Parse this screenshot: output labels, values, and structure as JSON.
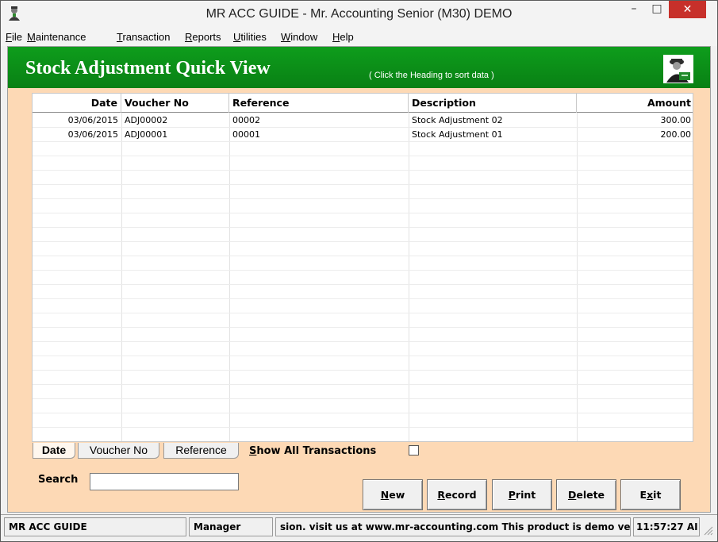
{
  "window": {
    "title": "MR ACC GUIDE - Mr. Accounting Senior (M30) DEMO",
    "min_glyph": "–",
    "max_glyph": "□",
    "close_glyph": "✕"
  },
  "menu": [
    {
      "pre": "",
      "u": "F",
      "post": "ile"
    },
    {
      "pre": "",
      "u": "M",
      "post": "aintenance"
    },
    {
      "pre": "",
      "u": "T",
      "post": "ransaction"
    },
    {
      "pre": "",
      "u": "R",
      "post": "eports"
    },
    {
      "pre": "",
      "u": "U",
      "post": "tilities"
    },
    {
      "pre": "",
      "u": "W",
      "post": "indow"
    },
    {
      "pre": "",
      "u": "H",
      "post": "elp"
    }
  ],
  "header": {
    "title": "Stock Adjustment Quick View",
    "hint": "( Click the Heading to sort data )",
    "logo_icon": "accountant-logo-icon",
    "accent": "#0b8f18"
  },
  "table": {
    "columns": [
      "Date",
      "Voucher No",
      "Reference",
      "Description",
      "Amount"
    ],
    "rows": [
      [
        "03/06/2015",
        "ADJ00002",
        "00002",
        "Stock Adjustment 02",
        "300.00"
      ],
      [
        "03/06/2015",
        "ADJ00001",
        "00001",
        "Stock Adjustment 01",
        "200.00"
      ]
    ]
  },
  "sort_tabs": {
    "date": "Date",
    "voucher": "Voucher No",
    "reference": "Reference",
    "active": "Date"
  },
  "show_all": {
    "label_u": "S",
    "label_rest": "how All Transactions",
    "checked": false
  },
  "search": {
    "label": "Search",
    "value": ""
  },
  "buttons": {
    "new": {
      "u": "N",
      "rest": "ew"
    },
    "record": {
      "u": "R",
      "rest": "ecord"
    },
    "print": {
      "u": "P",
      "rest": "rint"
    },
    "delete": {
      "u": "D",
      "rest": "elete"
    },
    "exit": {
      "pre": "E",
      "u": "x",
      "rest": "it"
    }
  },
  "status": {
    "app": "MR ACC GUIDE",
    "user": "Manager",
    "message": "sion.  visit us at www.mr-accounting.com This product is demo ver",
    "time": "11:57:27 AI"
  }
}
